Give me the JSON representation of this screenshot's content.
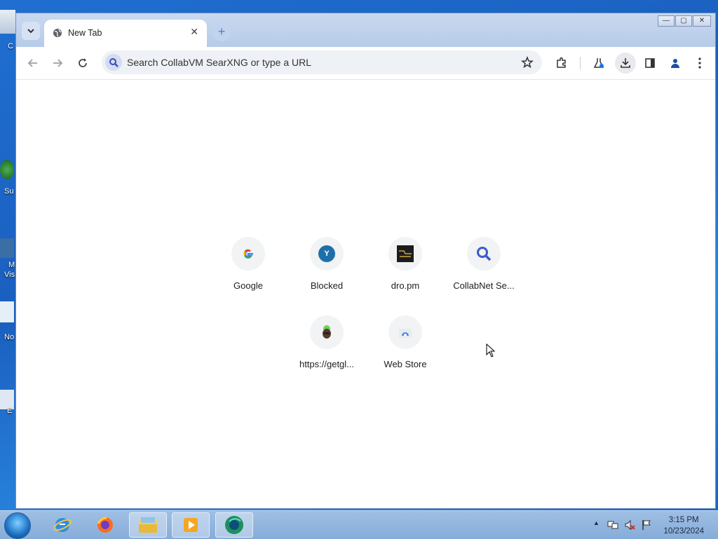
{
  "desktop": {
    "icon_labels": [
      "C",
      "Su",
      "M",
      "Vis",
      "No",
      "E"
    ]
  },
  "browser": {
    "tab": {
      "title": "New Tab"
    },
    "omnibox": {
      "placeholder": "Search CollabVM SearXNG or type a URL"
    },
    "window_controls": {
      "minimize": "—",
      "maximize": "▢",
      "close": "✕"
    },
    "icons": [
      "tab-search-icon",
      "globe-icon",
      "close-icon",
      "plus-icon",
      "back-icon",
      "forward-icon",
      "reload-icon",
      "search-icon",
      "star-icon",
      "extensions-icon",
      "labs-icon",
      "download-icon",
      "side-panel-icon",
      "profile-icon",
      "menu-icon"
    ]
  },
  "shortcuts": [
    {
      "label": "Google",
      "icon": "google-icon"
    },
    {
      "label": "Blocked",
      "icon": "letter-y-icon",
      "letter": "Y"
    },
    {
      "label": "dro.pm",
      "icon": "dropm-icon"
    },
    {
      "label": "CollabNet Se...",
      "icon": "search-icon"
    },
    {
      "label": "https://getgl...",
      "icon": "avatar-icon"
    },
    {
      "label": "Web Store",
      "icon": "webstore-icon"
    }
  ],
  "taskbar": {
    "apps": [
      "internet-explorer-icon",
      "firefox-icon",
      "file-explorer-icon",
      "media-player-icon",
      "chrome-icon"
    ],
    "clock_time": "3:15 PM",
    "clock_date": "10/23/2024"
  },
  "colors": {
    "accent": "#1a73e8",
    "desktop": "#1f6fd1",
    "tab_bar": "#c9d8ef"
  }
}
